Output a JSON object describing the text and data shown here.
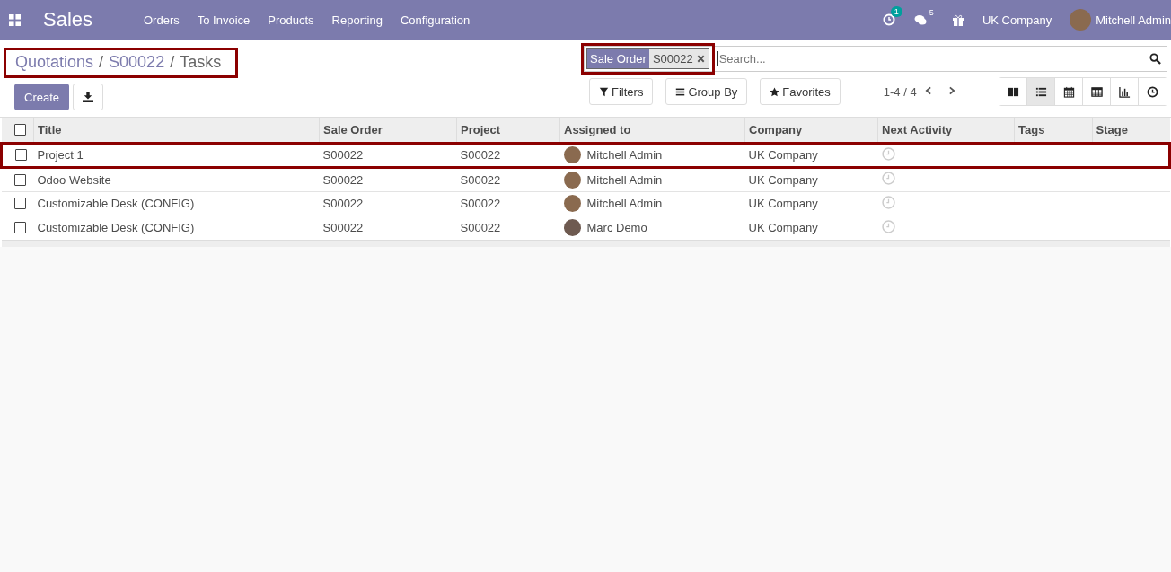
{
  "navbar": {
    "app": "Sales",
    "menu": [
      "Orders",
      "To Invoice",
      "Products",
      "Reporting",
      "Configuration"
    ],
    "activity_count": "1",
    "message_count": "5",
    "company": "UK Company",
    "user": "Mitchell Admin"
  },
  "breadcrumb": {
    "highlighted": true,
    "separators": [
      "/",
      "/"
    ],
    "items": [
      {
        "label": "Quotations",
        "link": true
      },
      {
        "label": "S00022",
        "link": true
      },
      {
        "label": "Tasks",
        "link": false
      }
    ]
  },
  "buttons": {
    "create": "Create"
  },
  "search": {
    "placeholder": "Search...",
    "facet": {
      "label": "Sale Order",
      "value": "S00022",
      "highlighted": true
    }
  },
  "filters": [
    "Filters",
    "Group By",
    "Favorites"
  ],
  "pager": "1-4 / 4",
  "views": [
    {
      "kind": "kanban",
      "selected": false
    },
    {
      "kind": "list",
      "selected": true
    },
    {
      "kind": "calendar",
      "selected": false
    },
    {
      "kind": "pivot",
      "selected": false
    },
    {
      "kind": "graph",
      "selected": false
    },
    {
      "kind": "activity",
      "selected": false
    }
  ],
  "table": {
    "all_checked": false,
    "columns": [
      "Title",
      "Sale Order",
      "Project",
      "Assigned to",
      "Company",
      "Next Activity",
      "Tags",
      "Stage"
    ],
    "rows": [
      {
        "title": "Project 1",
        "sale_order": "S00022",
        "project": "S00022",
        "assigned_to": "Mitchell Admin",
        "company": "UK Company",
        "checked": false,
        "highlighted": true
      },
      {
        "title": "Odoo Website",
        "sale_order": "S00022",
        "project": "S00022",
        "assigned_to": "Mitchell Admin",
        "company": "UK Company",
        "checked": false,
        "highlighted": false
      },
      {
        "title": "Customizable Desk (CONFIG)",
        "sale_order": "S00022",
        "project": "S00022",
        "assigned_to": "Mitchell Admin",
        "company": "UK Company",
        "checked": false,
        "highlighted": false
      },
      {
        "title": "Customizable Desk (CONFIG)",
        "sale_order": "S00022",
        "project": "S00022",
        "assigned_to": "Marc Demo",
        "company": "UK Company",
        "checked": false,
        "highlighted": false
      }
    ]
  }
}
